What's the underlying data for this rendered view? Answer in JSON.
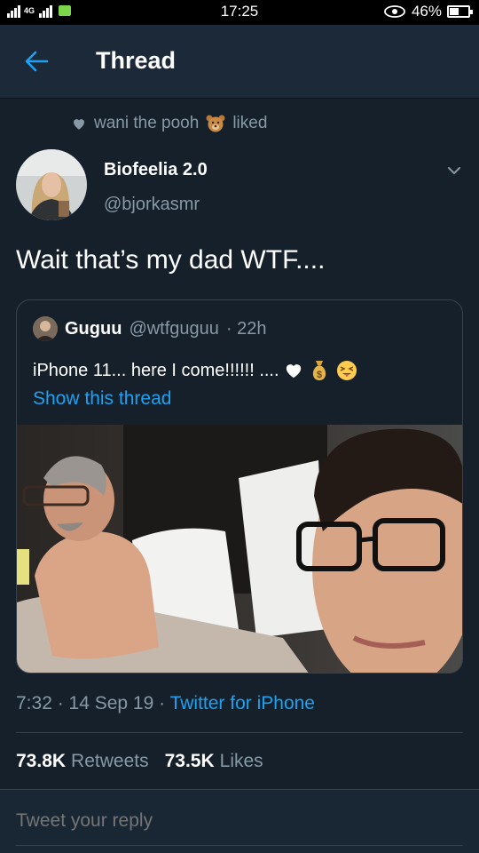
{
  "status_bar": {
    "time": "17:25",
    "battery": "46%",
    "network_tag": "4G",
    "battery_level": 0.46
  },
  "header": {
    "title": "Thread"
  },
  "liked": {
    "user": "wani the pooh",
    "action": "liked"
  },
  "tweet": {
    "author_name": "Biofeelia 2.0",
    "author_handle": "@bjorkasmr",
    "text": "Wait that’s my dad WTF....",
    "timestamp": "7:32 · 14 Sep 19 · ",
    "source": "Twitter for iPhone"
  },
  "quote": {
    "name": "Guguu",
    "handle": "@wtfguguu",
    "age": "· 22h",
    "text": "iPhone 11... here I come!!!!!!  ....",
    "emojis": [
      "heart",
      "money-bag",
      "squinting-tongue"
    ],
    "link": "Show this thread"
  },
  "stats": {
    "retweets_count": "73.8K",
    "retweets_label": "Retweets",
    "likes_count": "73.5K",
    "likes_label": "Likes"
  },
  "reply": {
    "placeholder": "Tweet your reply"
  },
  "colors": {
    "background": "#15202b",
    "header": "#1c2938",
    "accent": "#1da1f2",
    "muted": "#8899a6",
    "border": "#38444d"
  }
}
